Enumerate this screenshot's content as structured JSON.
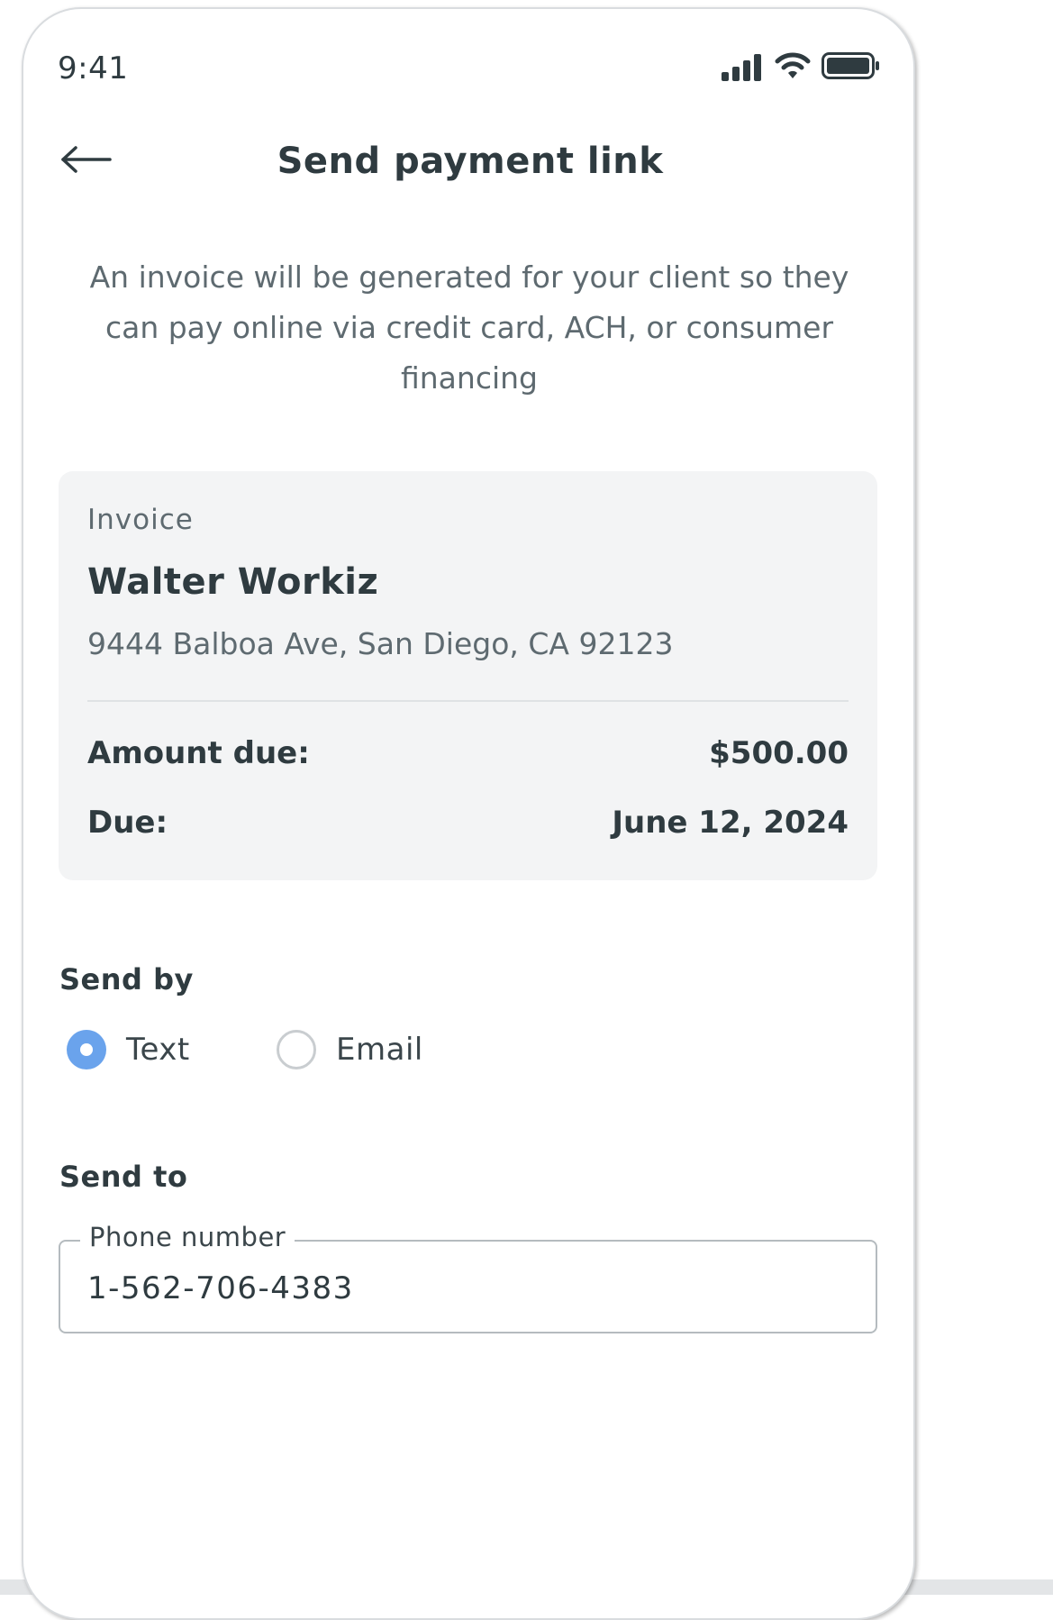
{
  "status_bar": {
    "time": "9:41"
  },
  "header": {
    "title": "Send payment link",
    "back_icon": "back-arrow-icon"
  },
  "description": "An invoice will be generated for your client so they can pay online via credit card, ACH, or consumer financing",
  "invoice": {
    "label": "Invoice",
    "client_name": "Walter Workiz",
    "address": "9444 Balboa Ave, San Diego, CA 92123",
    "amount_label": "Amount due:",
    "amount_value": "$500.00",
    "due_label": "Due:",
    "due_value": "June 12, 2024"
  },
  "send_by": {
    "title": "Send by",
    "options": [
      {
        "label": "Text",
        "selected": true
      },
      {
        "label": "Email",
        "selected": false
      }
    ]
  },
  "send_to": {
    "title": "Send to",
    "field_label": "Phone number",
    "field_value": "1-562-706-4383"
  },
  "colors": {
    "text_dark": "#2f3b40",
    "text_muted": "#5e6a70",
    "card_bg": "#f3f4f5",
    "radio_selected": "#6aa3ec",
    "field_border": "#b5bbbf"
  }
}
